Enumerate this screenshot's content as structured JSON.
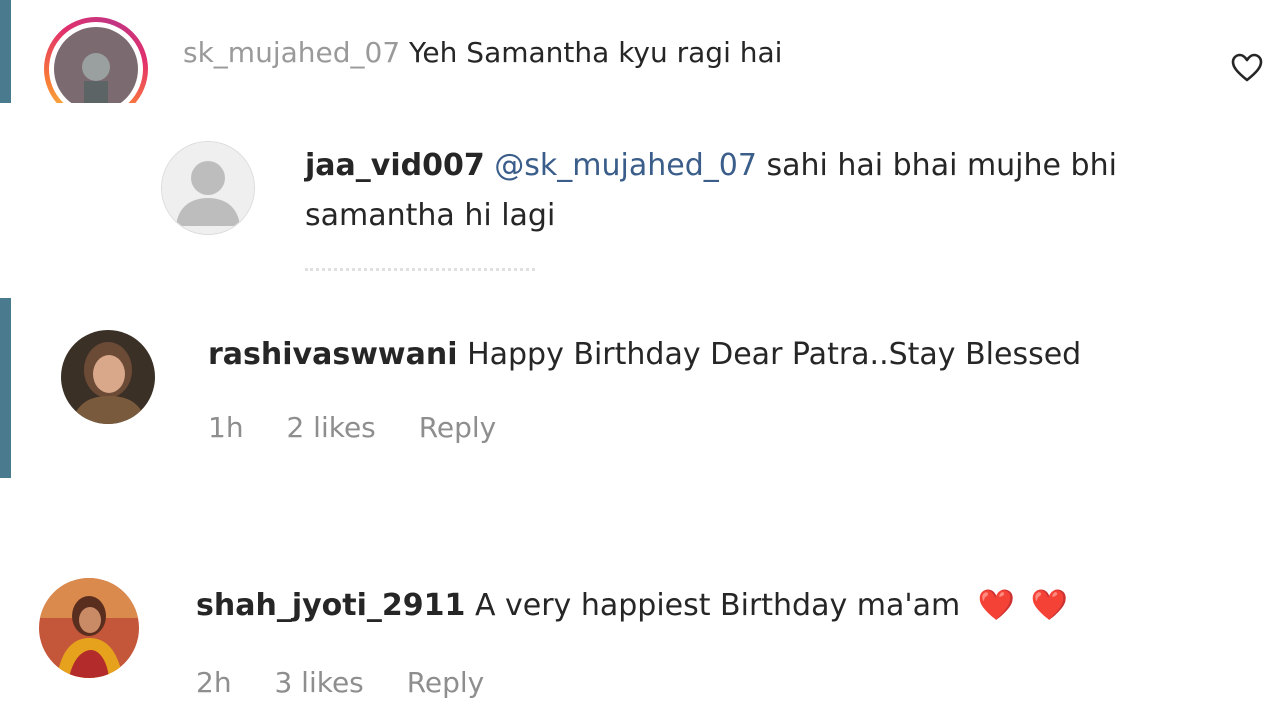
{
  "comments": [
    {
      "username": "sk_mujahed_07",
      "text": "Yeh Samantha kyu ragi hai",
      "avatar": "user-photo-avatar",
      "has_story_ring": true
    },
    {
      "username": "jaa_vid007",
      "mention": "@sk_mujahed_07",
      "text_line1": "sahi hai bhai mujhe bhi",
      "text_line2": "samantha hi lagi",
      "avatar": "default-profile-avatar"
    },
    {
      "username": "rashivaswwani",
      "text": "Happy Birthday Dear Patra..Stay Blessed",
      "time": "1h",
      "likes": "2 likes",
      "reply": "Reply",
      "avatar": "user-photo-avatar"
    },
    {
      "username": "shah_jyoti_2911",
      "text": "A very happiest Birthday ma'am",
      "emojis": [
        "❤️",
        "❤️"
      ],
      "time": "2h",
      "likes": "3 likes",
      "reply": "Reply",
      "avatar": "user-photo-avatar"
    }
  ],
  "icons": {
    "like": "heart-outline-icon",
    "emoji": "red-heart-emoji"
  },
  "colors": {
    "accent_bar": "#4a7a8e",
    "mention": "#3a5d8a",
    "meta": "#8e8e8e",
    "heart_emoji": "#e8102a"
  }
}
